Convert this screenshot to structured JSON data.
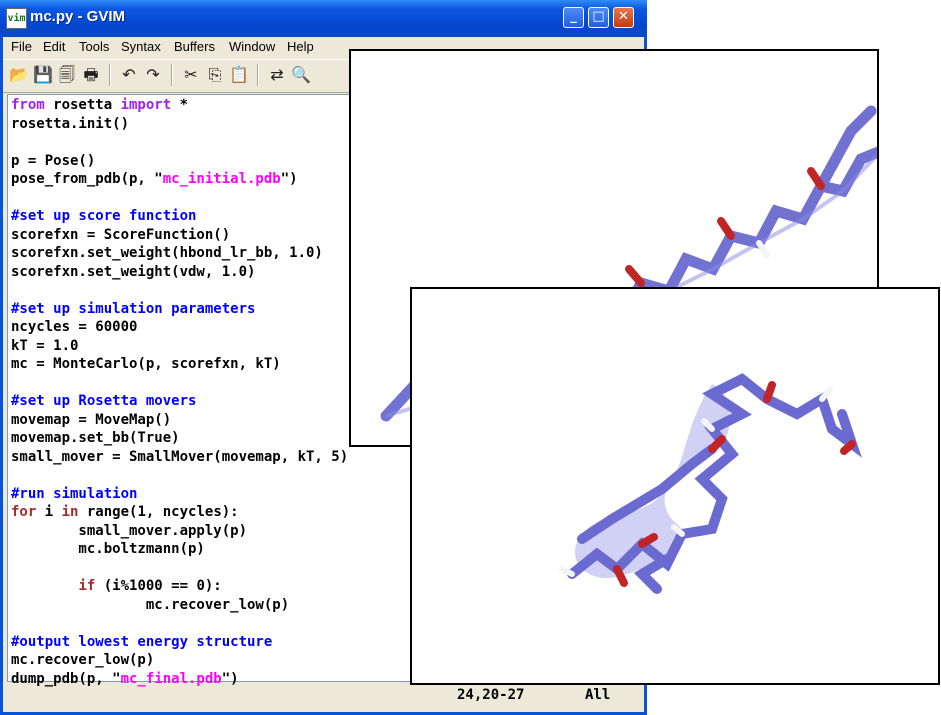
{
  "window": {
    "title": "mc.py - GVIM",
    "icon_label": "vim",
    "controls": [
      "minimize",
      "maximize",
      "close"
    ]
  },
  "menu": [
    "File",
    "Edit",
    "Tools",
    "Syntax",
    "Buffers",
    "Window",
    "Help"
  ],
  "toolbar_icons": [
    "open-icon",
    "save-icon",
    "save-all-icon",
    "print-icon",
    "undo-icon",
    "redo-icon",
    "cut-icon",
    "copy-icon",
    "paste-icon",
    "replace-icon",
    "find-icon"
  ],
  "code_lines": [
    "from rosetta import *",
    "rosetta.init()",
    "",
    "p = Pose()",
    "pose_from_pdb(p, \"mc_initial.pdb\")",
    "",
    "#set up score function",
    "scorefxn = ScoreFunction()",
    "scorefxn.set_weight(hbond_lr_bb, 1.0)",
    "scorefxn.set_weight(vdw, 1.0)",
    "",
    "#set up simulation parameters",
    "ncycles = 60000",
    "kT = 1.0",
    "mc = MonteCarlo(p, scorefxn, kT)",
    "",
    "#set up Rosetta movers",
    "movemap = MoveMap()",
    "movemap.set_bb(True)",
    "small_mover = SmallMover(movemap, kT, 5)",
    "",
    "#run simulation",
    "for i in range(1, ncycles):",
    "        small_mover.apply(p)",
    "        mc.boltzmann(p)",
    "",
    "        if (i%1000 == 0):",
    "                mc.recover_low(p)",
    "",
    "#output lowest energy structure",
    "mc.recover_low(p)",
    "dump_pdb(p, \"mc_final.pdb\")"
  ],
  "status": {
    "position": "24,20-27",
    "scroll": "All"
  },
  "colors": {
    "keyword_purple": "#a020f0",
    "keyword_brown": "#a52a2a",
    "string": "#ff00ff",
    "comment": "#0000ff",
    "carbon": "#7b7bd8",
    "oxygen": "#d02020",
    "hydrogen": "#f0f0f0"
  },
  "panels": [
    {
      "name": "initial-structure",
      "depiction": "extended beta strand"
    },
    {
      "name": "final-structure",
      "depiction": "alpha helix"
    }
  ]
}
